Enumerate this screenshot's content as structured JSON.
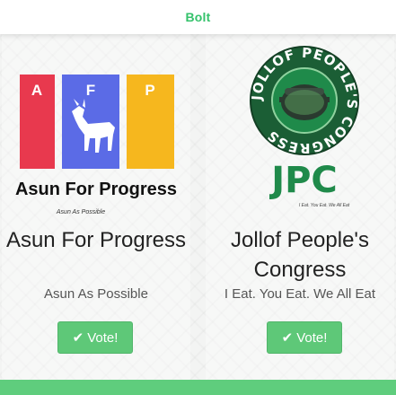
{
  "header": {
    "brand": "Bolt"
  },
  "parties": [
    {
      "logo": {
        "letters": [
          "A",
          "F",
          "P"
        ],
        "name": "Asun For Progress",
        "tagline": "Asun As Possible",
        "colors": {
          "red": "#e8394e",
          "blue": "#5b6be6",
          "yellow": "#f6b71e"
        }
      },
      "title": "Asun For Progress",
      "slogan": "Asun As Possible",
      "vote_label": "Vote!",
      "vote_icon": "check-icon"
    },
    {
      "logo": {
        "ring_text": "JOLLOF PEOPLE'S CONGRESS",
        "acronym": "JPC",
        "tagline": "I Eat. You Eat. We All Eat",
        "colors": {
          "green": "#1f8a4a",
          "ring": "#1b5e35"
        }
      },
      "title": "Jollof People's Congress",
      "slogan": "I Eat. You Eat. We All Eat",
      "vote_label": "Vote!",
      "vote_icon": "check-icon"
    }
  ],
  "colors": {
    "brand": "#34c26b",
    "button": "#5ec878",
    "footer": "#5fcd7d"
  }
}
